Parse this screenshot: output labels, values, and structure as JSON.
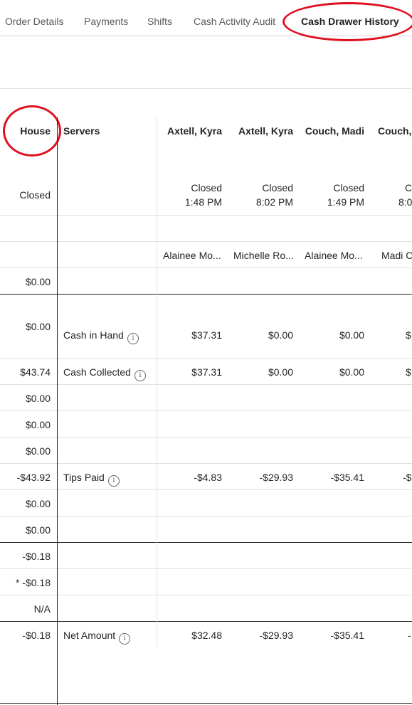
{
  "tabs": [
    "Order Details",
    "Payments",
    "Shifts",
    "Cash Activity Audit",
    "Cash Drawer History"
  ],
  "house": {
    "header": "House",
    "status": "Closed",
    "values": [
      "$0.00",
      "$0.00",
      "$43.74",
      "$0.00",
      "$0.00",
      "$0.00",
      "-$43.92",
      "$0.00",
      "$0.00",
      "-$0.18",
      "* -$0.18",
      "N/A",
      "-$0.18"
    ]
  },
  "servers_header": "Servers",
  "row_labels": {
    "cash_in_hand": "Cash in Hand",
    "cash_collected": "Cash Collected",
    "tips_paid": "Tips Paid",
    "net_amount": "Net Amount"
  },
  "info_icon": "i",
  "columns": [
    {
      "name": "Axtell, Kyra",
      "status": "Closed",
      "time": "1:48 PM",
      "manager": "Alainee Mo...",
      "cash_in_hand": "$37.31",
      "cash_collected": "$37.31",
      "tips_paid": "-$4.83",
      "net_amount": "$32.48"
    },
    {
      "name": "Axtell, Kyra",
      "status": "Closed",
      "time": "8:02 PM",
      "manager": "Michelle Ro...",
      "cash_in_hand": "$0.00",
      "cash_collected": "$0.00",
      "tips_paid": "-$29.93",
      "net_amount": "-$29.93"
    },
    {
      "name": "Couch, Madi",
      "status": "Closed",
      "time": "1:49 PM",
      "manager": "Alainee Mo...",
      "cash_in_hand": "$0.00",
      "cash_collected": "$0.00",
      "tips_paid": "-$35.41",
      "net_amount": "-$35.41"
    },
    {
      "name": "Couch, ",
      "status": "C",
      "time": "8:0",
      "manager": "Madi C",
      "cash_in_hand": "$",
      "cash_collected": "$",
      "tips_paid": "-$",
      "net_amount": "-"
    }
  ],
  "annotation_color": "#e01020"
}
